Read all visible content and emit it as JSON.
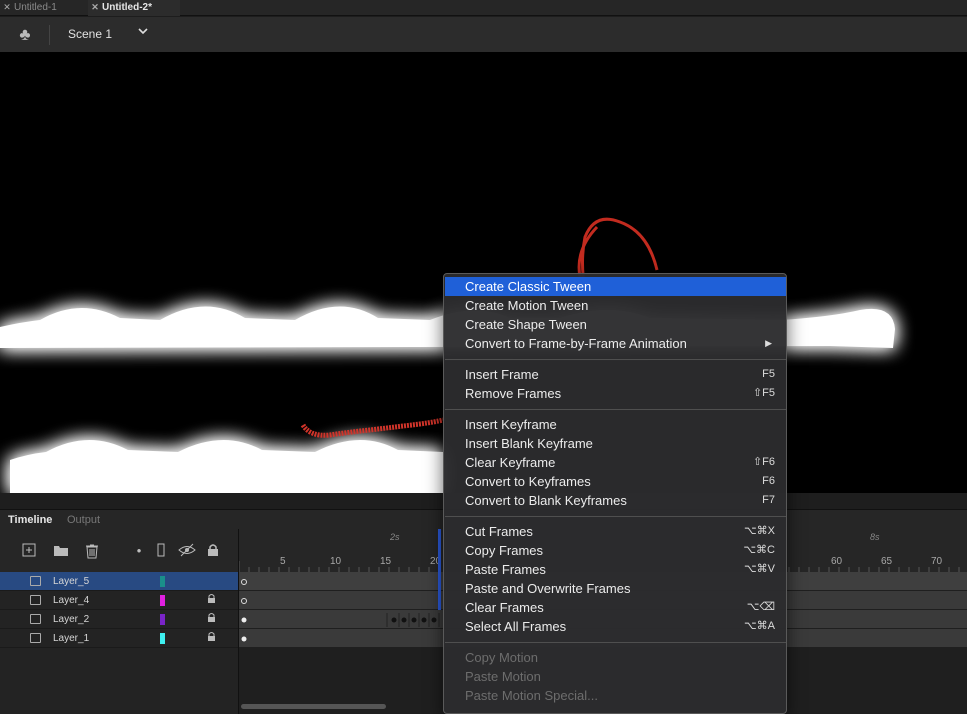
{
  "doc_tabs": [
    {
      "label": "Untitled-1",
      "close": "✕"
    },
    {
      "label": "Untitled-2*",
      "close": "✕"
    }
  ],
  "edit_bar": {
    "scene_label": "Scene 1",
    "scene_icon": "club-icon",
    "chevron": "⌄"
  },
  "panel_tabs": {
    "timeline": "Timeline",
    "output": "Output"
  },
  "layers": [
    {
      "name": "Layer_5",
      "color": "#1a8f8a",
      "locked": false,
      "selected": true
    },
    {
      "name": "Layer_4",
      "color": "#e020e0",
      "locked": true,
      "selected": false
    },
    {
      "name": "Layer_2",
      "color": "#7a24c8",
      "locked": true,
      "selected": false
    },
    {
      "name": "Layer_1",
      "color": "#3ef0f0",
      "locked": true,
      "selected": false
    }
  ],
  "ruler": {
    "ticks": [
      "5",
      "10",
      "15",
      "20",
      "60",
      "65",
      "70"
    ],
    "times": [
      "2s",
      "8s"
    ]
  },
  "context_menu": {
    "items": [
      {
        "label": "Create Classic Tween",
        "shortcut": "",
        "highlight": true
      },
      {
        "label": "Create Motion Tween",
        "shortcut": ""
      },
      {
        "label": "Create Shape Tween",
        "shortcut": ""
      },
      {
        "label": "Convert to Frame-by-Frame Animation",
        "shortcut": "",
        "submenu": "▶"
      },
      {
        "label": "Insert Frame",
        "shortcut": "F5"
      },
      {
        "label": "Remove Frames",
        "shortcut": "⇧F5"
      },
      {
        "label": "Insert Keyframe",
        "shortcut": ""
      },
      {
        "label": "Insert Blank Keyframe",
        "shortcut": ""
      },
      {
        "label": "Clear Keyframe",
        "shortcut": "⇧F6"
      },
      {
        "label": "Convert to Keyframes",
        "shortcut": "F6"
      },
      {
        "label": "Convert to Blank Keyframes",
        "shortcut": "F7"
      },
      {
        "label": "Cut Frames",
        "shortcut": "⌥⌘X"
      },
      {
        "label": "Copy Frames",
        "shortcut": "⌥⌘C"
      },
      {
        "label": "Paste Frames",
        "shortcut": "⌥⌘V"
      },
      {
        "label": "Paste and Overwrite Frames",
        "shortcut": ""
      },
      {
        "label": "Clear Frames",
        "shortcut": "⌥⌫"
      },
      {
        "label": "Select All Frames",
        "shortcut": "⌥⌘A"
      },
      {
        "label": "Copy Motion",
        "shortcut": "",
        "disabled": true
      },
      {
        "label": "Paste Motion",
        "shortcut": "",
        "disabled": true
      },
      {
        "label": "Paste Motion Special...",
        "shortcut": "",
        "disabled": true
      }
    ]
  }
}
